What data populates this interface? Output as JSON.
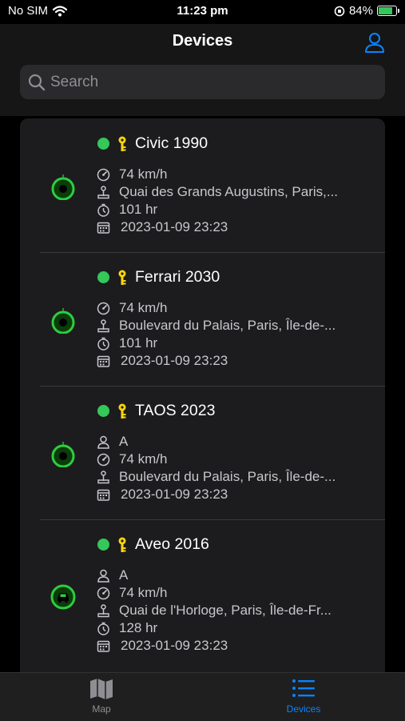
{
  "status_bar": {
    "carrier": "No SIM",
    "time": "11:23 pm",
    "battery": "84%",
    "battery_level": 0.84
  },
  "header": {
    "title": "Devices"
  },
  "search": {
    "placeholder": "Search"
  },
  "devices": [
    {
      "name": "Civic 1990",
      "online": true,
      "marker": "dot",
      "speed": "74 km/h",
      "address": "Quai des Grands Augustins, Paris,...",
      "hours": "101 hr",
      "datetime": "2023-01-09 23:23"
    },
    {
      "name": "Ferrari 2030",
      "online": true,
      "marker": "dot",
      "speed": "74 km/h",
      "address": "Boulevard du Palais, Paris, Île-de-...",
      "hours": "101 hr",
      "datetime": "2023-01-09 23:23"
    },
    {
      "name": "TAOS 2023",
      "online": true,
      "marker": "dot",
      "driver": "A",
      "speed": "74 km/h",
      "address": "Boulevard du Palais, Paris, Île-de-...",
      "datetime": "2023-01-09 23:23"
    },
    {
      "name": "Aveo 2016",
      "online": true,
      "marker": "car",
      "driver": "A",
      "speed": "74 km/h",
      "address": "Quai de l'Horloge, Paris, Île-de-Fr...",
      "hours": "128 hr",
      "datetime": "2023-01-09 23:23"
    }
  ],
  "tabs": [
    {
      "label": "Map",
      "selected": false
    },
    {
      "label": "Devices",
      "selected": true
    }
  ],
  "colors": {
    "accent": "#0a84ff",
    "online": "#34c759",
    "key": "#ffd60a",
    "marker_ring": "#2ecc40"
  }
}
